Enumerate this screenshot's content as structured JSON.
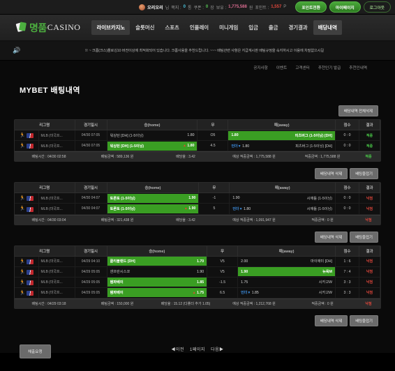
{
  "topbar": {
    "avatar_icon": "user-avatar",
    "nickname": "오리오리",
    "nickname_suffix": "님",
    "stats": [
      {
        "label": "쪽지 :",
        "value": "0",
        "unit": "통",
        "color": "#49c6e0"
      },
      {
        "label": "쿠폰 :",
        "value": "0",
        "unit": "장",
        "color": "#58c957"
      },
      {
        "label": "보유 :",
        "value": "1,775,588",
        "unit": "원",
        "color": "#d96b8f"
      },
      {
        "label": "포인트 :",
        "value": "1,557",
        "unit": "P",
        "color": "#e2473c"
      }
    ],
    "buttons": [
      {
        "label": "포인트전환",
        "style": "solid"
      },
      {
        "label": "마이페이지",
        "style": "solid"
      },
      {
        "label": "로그아웃",
        "style": "ghost"
      }
    ]
  },
  "nav": {
    "logo_kr": "명품",
    "logo_en": "CASINO",
    "items": [
      {
        "label": "라이브카지노",
        "state": "hl"
      },
      {
        "label": "슬롯머신",
        "state": "normal"
      },
      {
        "label": "스포츠",
        "state": "normal"
      },
      {
        "label": "인플레이",
        "state": "normal"
      },
      {
        "label": "미니게임",
        "state": "normal"
      },
      {
        "label": "입금",
        "state": "normal"
      },
      {
        "label": "출금",
        "state": "normal"
      },
      {
        "label": "경기결과",
        "state": "normal"
      },
      {
        "label": "배당내역",
        "state": "active"
      }
    ]
  },
  "notice": {
    "speaker_icon": "speaker-icon",
    "text": "※ ~ 크롬(크스)폴로깅10 버전이상에 최적화되어 있습니다. 크롬사용을 추천드립니다. ~~~ 배팅관련 사항은 지급계시판 배팅규정을 숙지하시고 이용에 차질없으시길"
  },
  "sublinks": [
    "공지사항",
    "이벤트",
    "고객센터",
    "추천인기 발급",
    "추천인내역"
  ],
  "page_title": "MYBET 배팅내역",
  "buttons": {
    "delete_all": "배당내역 전체삭제",
    "delete_one": "배당내역 삭제",
    "fold": "배팅줄접기",
    "request": "채출요청"
  },
  "table_headers": [
    "리그명",
    "경기일시",
    "승(home)",
    "무",
    "패(away)",
    "점수",
    "결과"
  ],
  "summary_labels": {
    "time": "배팅시간",
    "amount": "배팅금액",
    "rate": "배당율",
    "expected": "예상 적중금액",
    "hit": "적중금액"
  },
  "blocks": [
    {
      "rows": [
        {
          "league": "MLB (미국프...",
          "date": "04/30 07:05",
          "home": {
            "team": "워싱턴 [DH] (1-5이닝)",
            "odd": "1.80",
            "selected": false
          },
          "draw": "O5",
          "away": {
            "team": "피츠버그 (1-5이닝) [DH]",
            "odd": "1.80",
            "selected": true,
            "marker": ""
          },
          "score": "0 : 0",
          "result": "적중",
          "result_type": "win"
        },
        {
          "league": "MLB (미국프...",
          "date": "04/30 07:05",
          "home": {
            "team": "워싱턴 [DH] (1-5이닝)",
            "odd": "1.80",
            "selected": true,
            "marker": "up"
          },
          "draw": "4.5",
          "away": {
            "team": "피츠버그 (1-5이닝) [DH]",
            "odd": "1.80",
            "selected": false,
            "marker": "down",
            "marker_label": "언더"
          },
          "score": "0 : 0",
          "result": "적중",
          "result_type": "win"
        }
      ],
      "summary": {
        "time": "배팅시간 : 04/30 02:58",
        "amount": "배팅금액 : 589,136 원",
        "rate": "배당율 : 3.42",
        "expected": "예상 적중금액 : 1,775,588 원",
        "hit": "적중금액 : 1,775,588 원",
        "result": "적중",
        "result_type": "win"
      }
    },
    {
      "rows": [
        {
          "league": "MLB (미국프...",
          "date": "04/30 04:07",
          "home": {
            "team": "토론토 (1-5이닝)",
            "odd": "1.90",
            "selected": true
          },
          "draw": "-1",
          "away": {
            "team": "시애틀 (1-5이닝)",
            "odd": "1.90",
            "selected": false
          },
          "score": "0 : 0",
          "result": "낙첨",
          "result_type": "lose"
        },
        {
          "league": "MLB (미국프...",
          "date": "04/30 04:07",
          "home": {
            "team": "토론토 (1-5이닝)",
            "odd": "1.90",
            "selected": true,
            "marker": "up"
          },
          "draw": "5",
          "away": {
            "team": "시애틀 (1-5이닝)",
            "odd": "1.80",
            "selected": false,
            "marker": "down",
            "marker_label": "언더"
          },
          "score": "0 : 0",
          "result": "낙첨",
          "result_type": "lose"
        }
      ],
      "summary": {
        "time": "배팅시간 : 04/30 03:04",
        "amount": "배팅금액 : 321,438 원",
        "rate": "배당율 : 3.42",
        "expected": "예상 적중금액 : 1,091,947 원",
        "hit": "적중금액 : 0 원",
        "result": "낙첨",
        "result_type": "lose"
      }
    },
    {
      "rows": [
        {
          "league": "MLB (미국프...",
          "date": "04/29 04:10",
          "home": {
            "team": "클리블랜드 [DH]",
            "odd": "1.70",
            "selected": true
          },
          "draw": "V5",
          "away": {
            "team": "마이애미 [DH]",
            "odd": "2.00",
            "selected": false
          },
          "score": "1 : 6",
          "result": "낙첨",
          "result_type": "lose"
        },
        {
          "league": "MLB (미국프...",
          "date": "04/29 05:05",
          "home": {
            "team": "샌프란시스코",
            "odd": "1.90",
            "selected": false
          },
          "draw": "V5",
          "away": {
            "team": "뉴욕M",
            "odd": "1.90",
            "selected": true
          },
          "score": "7 : 4",
          "result": "낙첨",
          "result_type": "lose"
        },
        {
          "league": "MLB (미국프...",
          "date": "04/29 05:05",
          "home": {
            "team": "탬파베이",
            "odd": "1.85",
            "selected": true
          },
          "draw": "-1.5",
          "away": {
            "team": "시카고W",
            "odd": "1.75",
            "selected": false
          },
          "score": "3 : 3",
          "result": "낙첨",
          "result_type": "lose"
        },
        {
          "league": "MLB (미국프...",
          "date": "04/29 05:05",
          "home": {
            "team": "탬파베이",
            "odd": "1.75",
            "selected": true,
            "marker": "up"
          },
          "draw": "6.5",
          "away": {
            "team": "시카고W",
            "odd": "1.85",
            "selected": false,
            "marker": "down",
            "marker_label": "언더"
          },
          "score": "3 : 3",
          "result": "낙첨",
          "result_type": "lose"
        }
      ],
      "summary": {
        "time": "배팅시간 : 04/29 03:18",
        "amount": "배팅금액 : 150,000 원",
        "rate": "배당율 : 15.12 (다폴더 추가 1.05)",
        "expected": "예상 적중금액 : 1,212,768 원",
        "hit": "적중금액 : 0 원",
        "result": "낙첨",
        "result_type": "lose"
      }
    }
  ],
  "pagination": {
    "prev": "◀이전",
    "current": "1페이지",
    "next": "다음▶"
  }
}
